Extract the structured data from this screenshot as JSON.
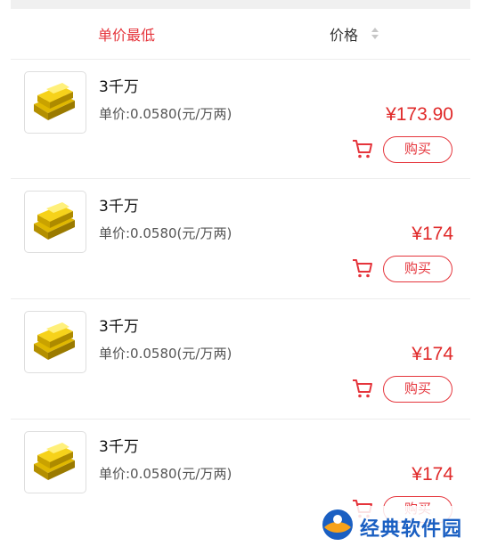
{
  "sort": {
    "unit_price_lowest": "单价最低",
    "price": "价格"
  },
  "items": [
    {
      "name": "3千万",
      "unit_price": "单价:0.0580(元/万两)",
      "price": "¥173.90",
      "buy_label": "购买"
    },
    {
      "name": "3千万",
      "unit_price": "单价:0.0580(元/万两)",
      "price": "¥174",
      "buy_label": "购买"
    },
    {
      "name": "3千万",
      "unit_price": "单价:0.0580(元/万两)",
      "price": "¥174",
      "buy_label": "购买"
    },
    {
      "name": "3千万",
      "unit_price": "单价:0.0580(元/万两)",
      "price": "¥174",
      "buy_label": "购买"
    }
  ],
  "watermark": {
    "text": "经典软件园"
  },
  "icons": {
    "item_image": "gold-bars-icon",
    "cart": "cart-icon",
    "sort": "sort-arrows-icon"
  },
  "colors": {
    "accent": "#e5353c",
    "price": "#e02a2a",
    "watermark": "#1a5fc2"
  }
}
